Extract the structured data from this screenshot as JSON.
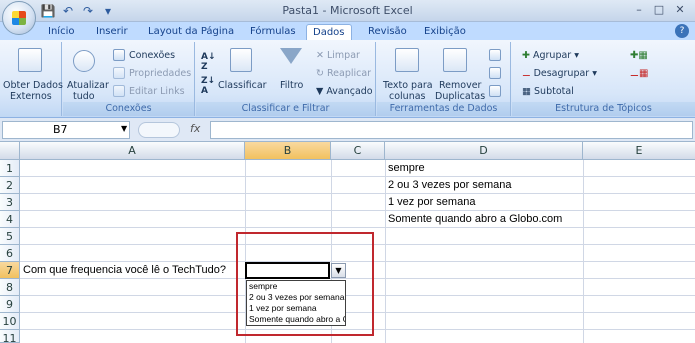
{
  "window": {
    "title": "Pasta1 - Microsoft Excel"
  },
  "tabs": [
    {
      "label": "Início"
    },
    {
      "label": "Inserir"
    },
    {
      "label": "Layout da Página"
    },
    {
      "label": "Fórmulas"
    },
    {
      "label": "Dados",
      "active": true
    },
    {
      "label": "Revisão"
    },
    {
      "label": "Exibição"
    }
  ],
  "ribbon": {
    "obter_dados_line1": "Obter Dados",
    "obter_dados_line2": "Externos",
    "atualizar_line1": "Atualizar",
    "atualizar_line2": "tudo",
    "conexoes": "Conexões",
    "propriedades": "Propriedades",
    "editar_links": "Editar Links",
    "group_conexoes": "Conexões",
    "classificar": "Classificar",
    "filtro": "Filtro",
    "limpar": "Limpar",
    "reaplicar": "Reaplicar",
    "avancado": "Avançado",
    "group_classificar": "Classificar e Filtrar",
    "texto_line1": "Texto para",
    "texto_line2": "colunas",
    "remover_line1": "Remover",
    "remover_line2": "Duplicatas",
    "group_ferramentas": "Ferramentas de Dados",
    "agrupar": "Agrupar",
    "desagrupar": "Desagrupar",
    "subtotal": "Subtotal",
    "group_estrutura": "Estrutura de Tópicos"
  },
  "formula_bar": {
    "name_box": "B7",
    "fx": "fx",
    "formula": ""
  },
  "columns": [
    "A",
    "B",
    "C",
    "D",
    "E"
  ],
  "rows": [
    "1",
    "2",
    "3",
    "4",
    "5",
    "6",
    "7",
    "8",
    "9",
    "10",
    "11"
  ],
  "cells": {
    "A7": "Com que frequencia você lê o TechTudo?",
    "D1": "sempre",
    "D2": "2 ou 3 vezes por semana",
    "D3": "1 vez por semana",
    "D4": "Somente quando abro a Globo.com"
  },
  "dropdown": {
    "options": [
      "sempre",
      "2 ou 3 vezes por semana",
      "1 vez por semana",
      "Somente quando abro a Globo.com"
    ]
  },
  "colors": {
    "highlight_box": "#c0282e",
    "selected_header": "#f1c15f"
  }
}
